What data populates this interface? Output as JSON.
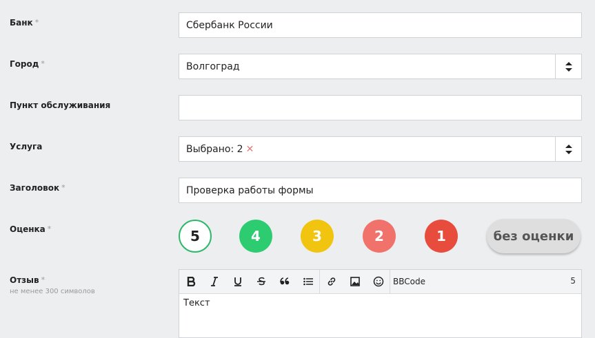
{
  "form": {
    "bank": {
      "label": "Банк",
      "req": "*",
      "value": "Сбербанк России"
    },
    "city": {
      "label": "Город",
      "req": "*",
      "value": "Волгоград"
    },
    "branch": {
      "label": "Пункт обслуживания",
      "value": ""
    },
    "service": {
      "label": "Услуга",
      "value": "Выбрано: 2",
      "clear": "✕"
    },
    "title": {
      "label": "Заголовок",
      "req": "*",
      "value": "Проверка работы формы"
    },
    "rating": {
      "label": "Оценка",
      "req": "*",
      "options": [
        {
          "value": "5",
          "color": "#ffffff",
          "selected": true
        },
        {
          "value": "4",
          "color": "#2ecc71"
        },
        {
          "value": "3",
          "color": "#f1c40f"
        },
        {
          "value": "2",
          "color": "#f0726a"
        },
        {
          "value": "1",
          "color": "#e74c3c"
        }
      ],
      "none_label": "без оценки"
    },
    "review": {
      "label": "Отзыв",
      "req": "*",
      "hint": "не менее 300 символов",
      "toolbar": {
        "bbcode": "BBCode",
        "counter": "5"
      },
      "text": "Текст"
    }
  }
}
